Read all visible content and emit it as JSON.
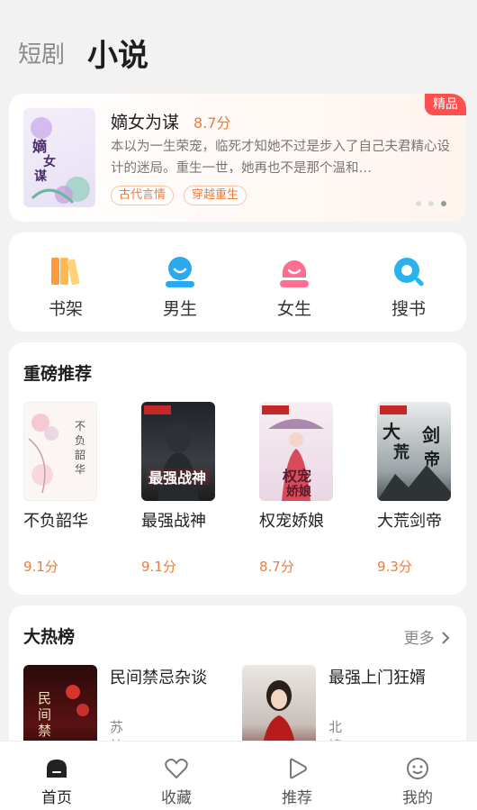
{
  "top_tabs": {
    "inactive": "短剧",
    "active": "小说"
  },
  "featured": {
    "badge": "精品",
    "title": "嫡女为谋",
    "score": "8.7分",
    "description": "本以为一生荣宠，临死才知她不过是步入了自己夫君精心设计的迷局。重生一世，她再也不是那个温和…",
    "tags": [
      "古代言情",
      "穿越重生"
    ],
    "cover_text": "嫡女为谋"
  },
  "categories": [
    {
      "label": "书架",
      "icon": "bookshelf-icon"
    },
    {
      "label": "男生",
      "icon": "male-icon"
    },
    {
      "label": "女生",
      "icon": "female-icon"
    },
    {
      "label": "搜书",
      "icon": "search-icon"
    }
  ],
  "recommend": {
    "title": "重磅推荐",
    "books": [
      {
        "title": "不负韶华",
        "score": "9.1分"
      },
      {
        "title": "最强战神",
        "score": "9.1分"
      },
      {
        "title": "权宠娇娘",
        "score": "8.7分"
      },
      {
        "title": "大荒剑帝",
        "score": "9.3分"
      }
    ]
  },
  "hot": {
    "title": "大热榜",
    "more": "更多",
    "items": [
      {
        "title": "民间禁忌杂谈",
        "author": "苏皖"
      },
      {
        "title": "最强上门狂婿",
        "author": "北境"
      }
    ]
  },
  "tabbar": [
    {
      "label": "首页",
      "icon": "home-icon"
    },
    {
      "label": "收藏",
      "icon": "heart-icon"
    },
    {
      "label": "推荐",
      "icon": "play-icon"
    },
    {
      "label": "我的",
      "icon": "profile-icon"
    }
  ],
  "colors": {
    "accent": "#f07a3a",
    "badge": "#ff4f4f",
    "blue": "#2aa9f0",
    "pink": "#ff6e8e"
  }
}
